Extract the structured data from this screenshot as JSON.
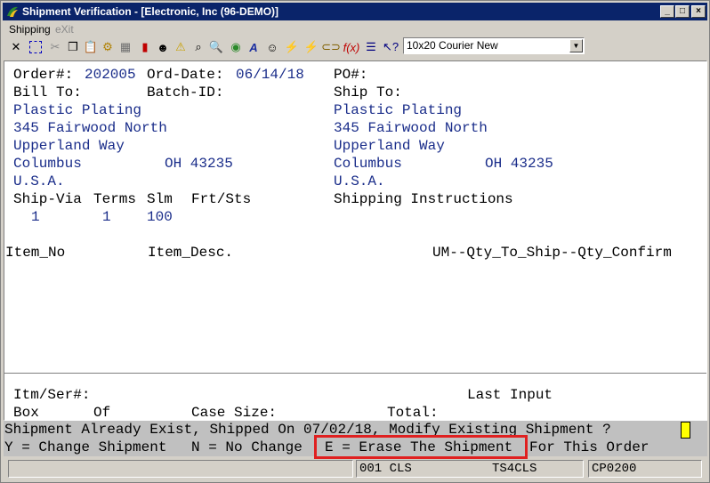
{
  "window": {
    "title": "Shipment Verification - [Electronic, Inc (96-DEMO)]",
    "minimize": "_",
    "maximize": "□",
    "close": "×"
  },
  "menu": {
    "shipping": "Shipping",
    "exit": "eXit"
  },
  "toolbar": {
    "font_value": "10x20 Courier New"
  },
  "order": {
    "order_label": "Order#:",
    "order_no": "202005",
    "date_label": "Ord-Date:",
    "date": "06/14/18",
    "po_label": "PO#:",
    "bill_to_label": "Bill To:",
    "batch_label": "Batch-ID:",
    "ship_to_label": "Ship To:"
  },
  "bill_to": {
    "name": "Plastic Plating",
    "addr1": "345 Fairwood North",
    "addr2": "Upperland Way",
    "city": "Columbus",
    "state_zip": "OH 43235",
    "country": "U.S.A."
  },
  "ship_to": {
    "name": "Plastic Plating",
    "addr1": "345 Fairwood North",
    "addr2": "Upperland Way",
    "city": "Columbus",
    "state_zip": "OH 43235",
    "country": "U.S.A."
  },
  "terms": {
    "shipvia_label": "Ship-Via",
    "terms_label": "Terms",
    "slm_label": "Slm",
    "frt_label": "Frt/Sts",
    "shipvia": "1",
    "terms": "1",
    "slm": "100",
    "instr_label": "Shipping Instructions"
  },
  "items": {
    "item_no": "Item_No",
    "item_desc": "Item_Desc.",
    "qty_header": "UM--Qty_To_Ship--Qty_Confirm"
  },
  "entry": {
    "itm_ser": "Itm/Ser#:",
    "last_input": "Last Input",
    "box": "Box",
    "of": "Of",
    "case_size": "Case Size:",
    "total": "Total:"
  },
  "prompt": {
    "line1": "Shipment Already Exist, Shipped On 07/02/18, Modify Existing Shipment ?",
    "y_opt": "Y = Change Shipment",
    "n_opt": "N = No Change",
    "e_opt": "E = Erase The Shipment",
    "tail": "For This Order"
  },
  "status": {
    "p1": "",
    "p2": "001 CLS",
    "p3": "TS4CLS",
    "p4": "CP0200"
  },
  "colors": {
    "titlebar": "#0a246a",
    "address_text": "#1a2d8a",
    "highlight": "#e02020",
    "indicator": "#ffff00"
  }
}
